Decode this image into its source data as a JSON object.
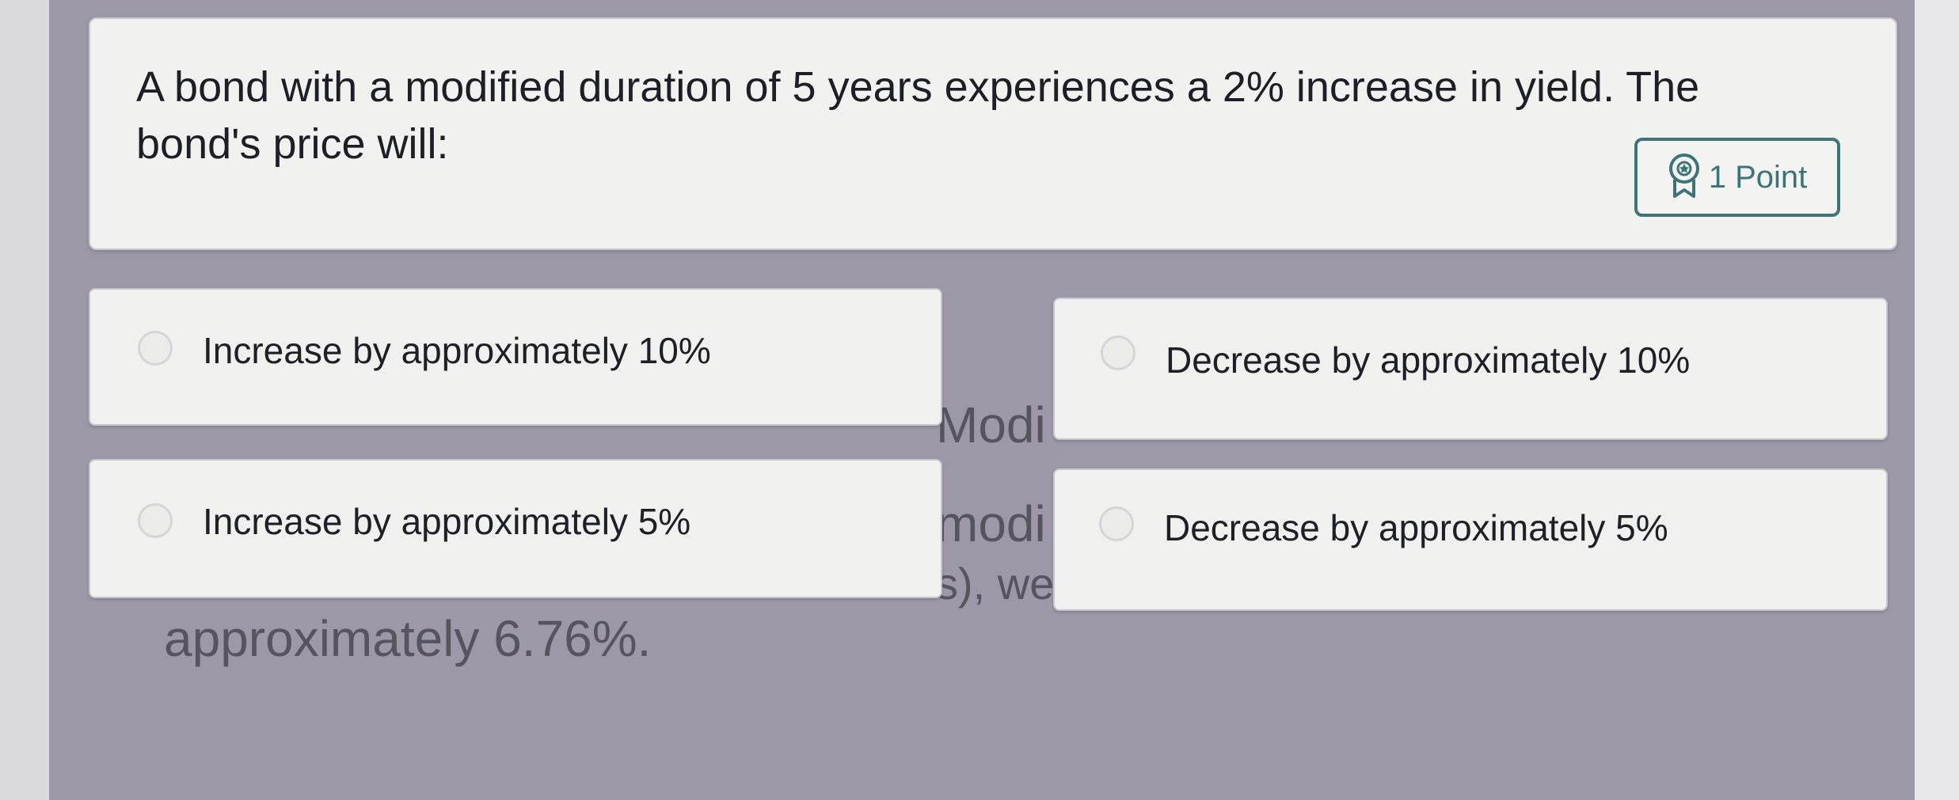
{
  "question": {
    "text": "A bond with a modified duration of 5 years experiences a 2% increase in yield. The bond's price will:",
    "points_label": "1 Point"
  },
  "options": [
    {
      "label": "Increase by approximately 10%"
    },
    {
      "label": "Decrease by approximately 10%"
    },
    {
      "label": "Increase by approximately 5%"
    },
    {
      "label": "Decrease by approximately 5%"
    }
  ],
  "background_explanation": {
    "fragment_1": "Modi",
    "fragment_2": "modi",
    "fragment_3": "s), we",
    "fragment_4": "approximately 6.76%."
  },
  "icons": {
    "points": "award-ribbon-icon",
    "radio": "radio-unselected-icon"
  },
  "colors": {
    "accent_teal": "#3c7477",
    "card_bg": "#f0f0ee",
    "panel_bg": "#9c98a8"
  }
}
